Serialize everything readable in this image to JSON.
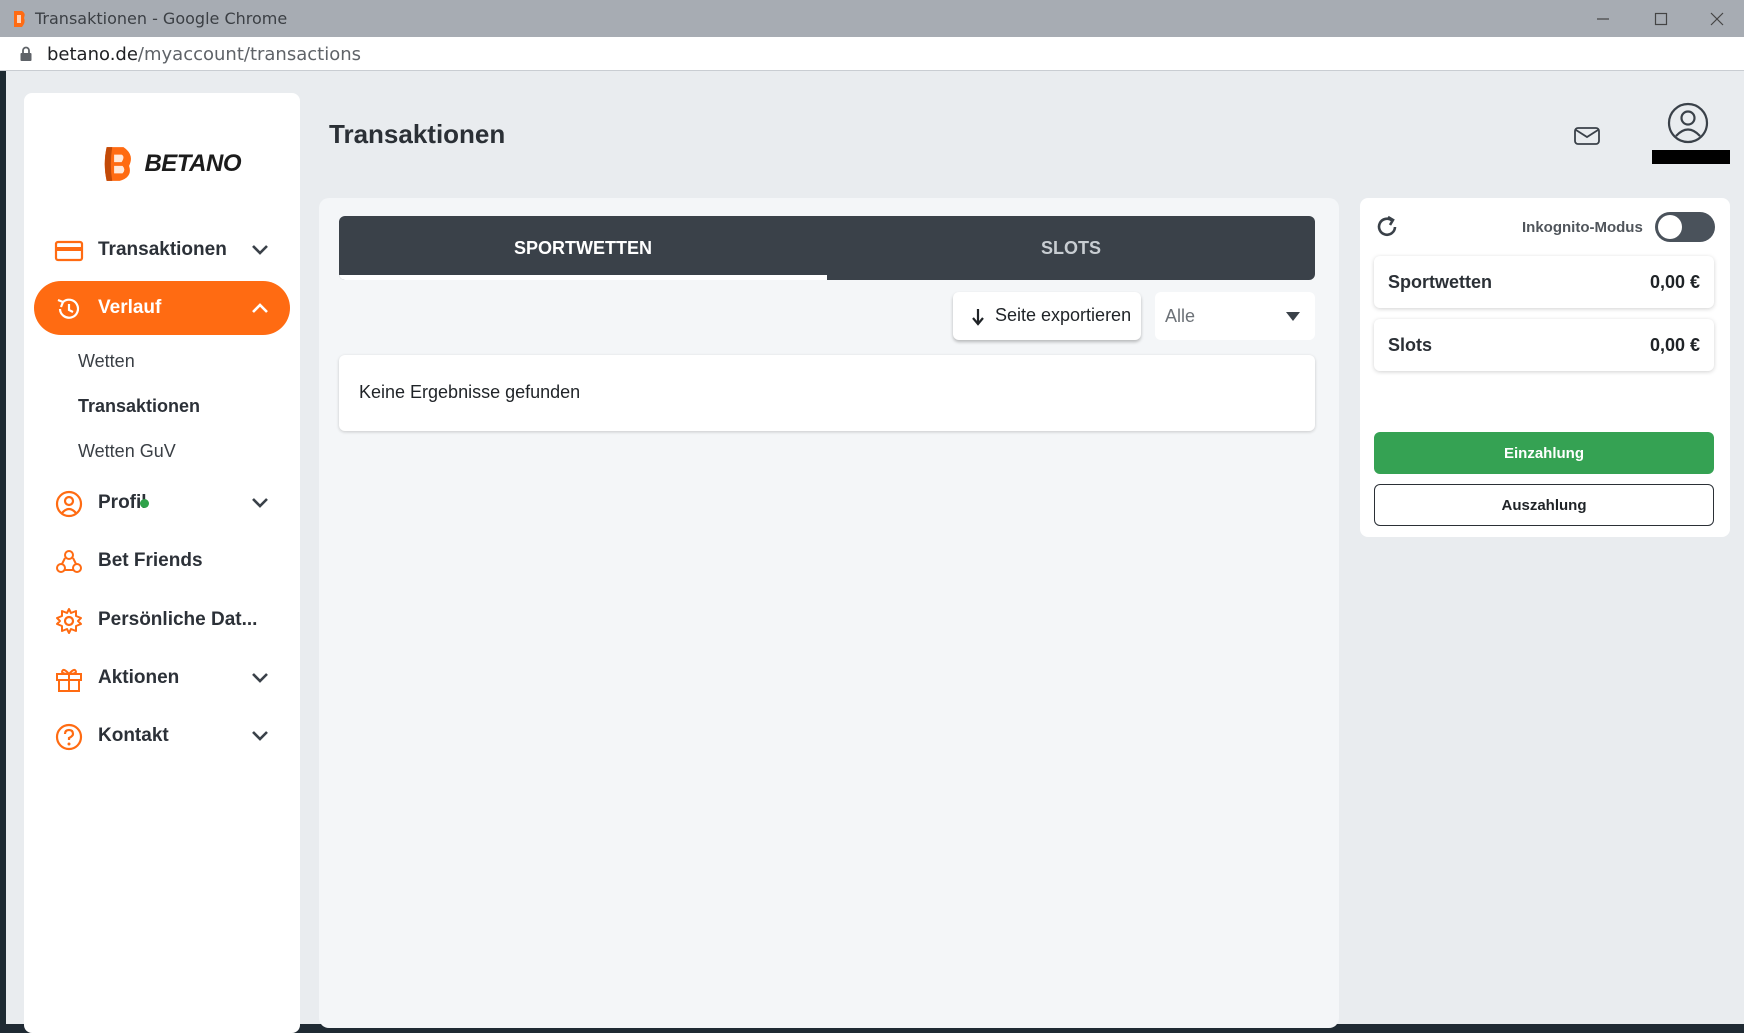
{
  "window": {
    "title": "Transaktionen - Google Chrome",
    "url_host": "betano.de",
    "url_path": "/myaccount/transactions"
  },
  "brand": {
    "name": "BETANO",
    "accent": "#ff6b12"
  },
  "sidebar": {
    "items": [
      {
        "label": "Transaktionen",
        "icon": "card-icon"
      },
      {
        "label": "Verlauf",
        "icon": "history-icon"
      },
      {
        "label": "Profil",
        "icon": "user-icon"
      },
      {
        "label": "Bet Friends",
        "icon": "friends-icon"
      },
      {
        "label": "Persönliche Dat...",
        "icon": "gear-icon"
      },
      {
        "label": "Aktionen",
        "icon": "gift-icon"
      },
      {
        "label": "Kontakt",
        "icon": "help-icon"
      }
    ],
    "verlauf_sub": [
      "Wetten",
      "Transaktionen",
      "Wetten GuV"
    ]
  },
  "header": {
    "title": "Transaktionen"
  },
  "tabs": [
    "SPORTWETTEN",
    "SLOTS"
  ],
  "toolbar": {
    "export_label": "Seite exportieren",
    "filter_value": "Alle"
  },
  "results": {
    "empty_message": "Keine Ergebnisse gefunden"
  },
  "wallet": {
    "incognito_label": "Inkognito-Modus",
    "balances": [
      {
        "label": "Sportwetten",
        "value": "0,00 €"
      },
      {
        "label": "Slots",
        "value": "0,00 €"
      }
    ],
    "deposit_label": "Einzahlung",
    "withdraw_label": "Auszahlung"
  }
}
